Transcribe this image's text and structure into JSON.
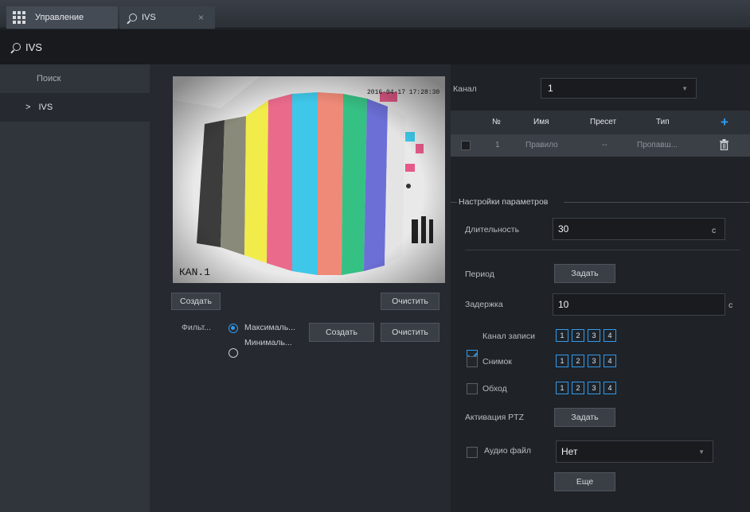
{
  "tabs": [
    {
      "label": "Управление"
    },
    {
      "label": "IVS",
      "close": "×"
    }
  ],
  "header": {
    "title": "IVS"
  },
  "sidebar": {
    "items": [
      {
        "label": "Поиск"
      },
      {
        "label": "IVS",
        "chevron": ">"
      }
    ]
  },
  "video": {
    "overlay_time": "2016-04-17 17:28:30",
    "overlay_channel": "КАN.1"
  },
  "left_actions": {
    "create_label": "Создать",
    "clear_label": "Очистить"
  },
  "filter": {
    "label": "Фильт...",
    "options": [
      "Максималь...",
      "Минималь..."
    ],
    "create_label": "Создать",
    "clear_label": "Очистить"
  },
  "channel": {
    "label": "Канал",
    "value": "1"
  },
  "rules_table": {
    "headers": [
      "№",
      "Имя",
      "Пресет",
      "Тип"
    ],
    "rows": [
      {
        "num": "1",
        "name": "Правило",
        "preset": "--",
        "type": "Пропавш..."
      }
    ]
  },
  "params": {
    "legend": "Настройки параметров",
    "duration_label": "Длительность",
    "duration_value": "30",
    "duration_unit": "с",
    "period_label": "Период",
    "period_button": "Задать",
    "delay_label": "Задержка",
    "delay_value": "10",
    "delay_unit": "с",
    "record_label": "Канал записи",
    "snapshot_label": "Снимок",
    "tour_label": "Обход",
    "channel_numbers": [
      "1",
      "2",
      "3",
      "4"
    ],
    "ptz_label": "Активация PTZ",
    "ptz_button": "Задать",
    "audio_label": "Аудио файл",
    "audio_value": "Нет",
    "more_button": "Еще"
  },
  "colors": {
    "accent": "#2f9bf0"
  }
}
